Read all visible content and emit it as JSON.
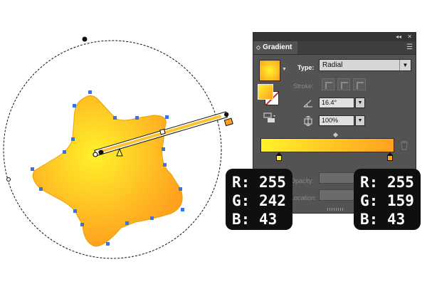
{
  "panel": {
    "close_glyph": "◂◂",
    "close_x": "✕",
    "tab_label": "Gradient",
    "tab_arrow": "◇",
    "menu_icon": "☰",
    "type_label": "Type:",
    "type_value": "Radial",
    "stroke_label": "Stroke:",
    "angle_value": "16.4°",
    "aspect_value": "100%",
    "opacity_label": "Opacity:",
    "location_label": "Location:"
  },
  "tooltips": [
    {
      "r_label": "R:",
      "r": "255",
      "g_label": "G:",
      "g": "242",
      "b_label": "B:",
      "b": "43"
    },
    {
      "r_label": "R:",
      "r": "255",
      "g_label": "G:",
      "g": "159",
      "b_label": "B:",
      "b": "43"
    }
  ],
  "colors": {
    "stop_start": "#fff22b",
    "stop_end": "#ffa01f",
    "panel_bg": "#535353",
    "anchor": "#3a74e0"
  },
  "icons": [
    "close-icon",
    "panel-menu-icon",
    "angle-icon",
    "aspect-ratio-icon",
    "trash-icon",
    "gradient-stop-icon",
    "reverse-gradient-icon"
  ]
}
